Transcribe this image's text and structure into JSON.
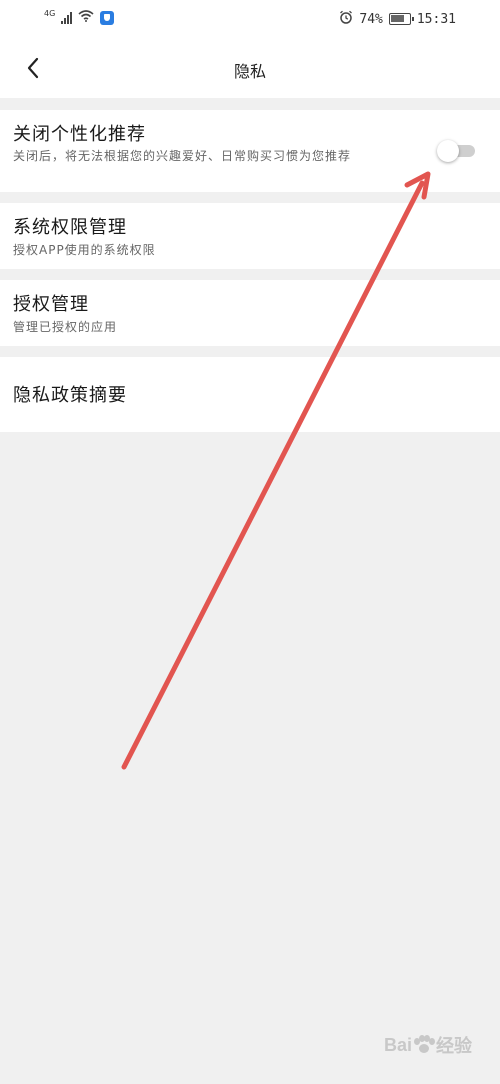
{
  "status_bar": {
    "network": "4G",
    "battery": "74%",
    "battery_level": 0.74,
    "time": "15:31"
  },
  "header": {
    "title": "隐私"
  },
  "settings": [
    {
      "title": "关闭个性化推荐",
      "subtitle": "关闭后，将无法根据您的兴趣爱好、日常购买习惯为您推荐",
      "toggle": "off"
    },
    {
      "title": "系统权限管理",
      "subtitle": "授权APP使用的系统权限"
    },
    {
      "title": "授权管理",
      "subtitle": "管理已授权的应用"
    },
    {
      "title": "隐私政策摘要"
    }
  ],
  "annotation": {
    "arrow_color": "#e25550"
  },
  "watermark": {
    "text": "Bai",
    "text2": "经验"
  }
}
